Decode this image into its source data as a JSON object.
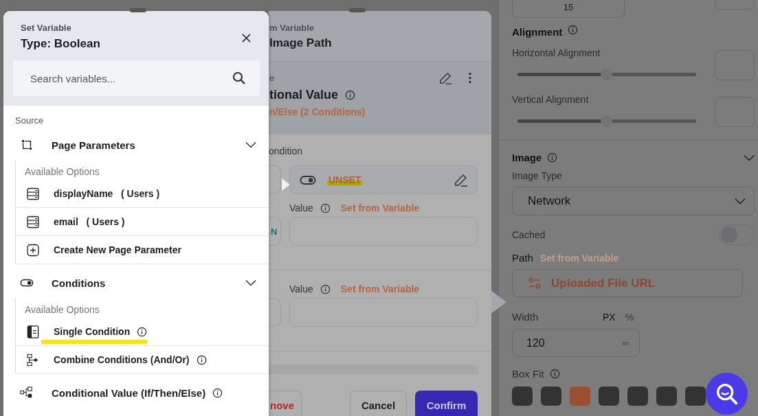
{
  "set_variable_panel": {
    "caption": "Set Variable",
    "title": "Type: Boolean",
    "search": {
      "placeholder": "Search variables..."
    },
    "source_label": "Source",
    "groups": [
      {
        "kind": "parameters",
        "label": "Page Parameters",
        "expanded": true,
        "options_label": "Available Options",
        "items": [
          {
            "kind": "field",
            "label": "displayName",
            "suffix": "( Users )",
            "info": false,
            "highlighted": false
          },
          {
            "kind": "field",
            "label": "email",
            "suffix": "( Users )",
            "info": false,
            "highlighted": false
          },
          {
            "kind": "create",
            "label": "Create New Page Parameter",
            "info": false,
            "highlighted": false
          }
        ]
      },
      {
        "kind": "conditions",
        "label": "Conditions",
        "expanded": true,
        "options_label": "Available Options",
        "items": [
          {
            "kind": "single",
            "label": "Single Condition",
            "info": true,
            "highlighted": true
          },
          {
            "kind": "combine",
            "label": "Combine Conditions (And/Or)",
            "info": true,
            "highlighted": false
          }
        ]
      },
      {
        "kind": "conditional",
        "label": "Conditional Value (If/Then/Else)",
        "info": true
      }
    ]
  },
  "value_panel": {
    "caption": "m Variable",
    "title": "Image Path",
    "section_caption": "e",
    "value_title": "tional Value",
    "value_subtitle": "n/Else (2 Conditions)",
    "condition_label": "ondition",
    "condition_chip": {
      "text": "UNSET",
      "highlighted": true
    },
    "rows": [
      {
        "label": "Value",
        "link": "Set from Variable",
        "fragment": "N"
      },
      {
        "label": "Value",
        "link": "Set from Variable"
      }
    ],
    "buttons": [
      {
        "kind": "danger",
        "label": "nove"
      },
      {
        "kind": "secondary",
        "label": "Cancel"
      },
      {
        "kind": "primary",
        "label": "Confirm"
      }
    ]
  },
  "properties": {
    "top_value": "15",
    "alignment_title": "Alignment",
    "sliders": [
      {
        "label": "Horizontal Alignment",
        "level": 0.5
      },
      {
        "label": "Vertical Alignment",
        "level": 0.5
      }
    ],
    "image_title": "Image",
    "image_type_label": "Image Type",
    "image_type": "Network",
    "cached_label": "Cached",
    "cached": false,
    "path_label": "Path",
    "path_link": "Set from Variable",
    "path_value": "Uploaded File URL",
    "width_label": "Width",
    "units": [
      {
        "label": "PX",
        "selected": true
      },
      {
        "label": "%",
        "selected": false
      }
    ],
    "width_value": "120",
    "width_suffix": "∞",
    "box_fit_label": "Box Fit",
    "box_fit_options": [
      {
        "selected": false
      },
      {
        "selected": false
      },
      {
        "selected": true
      },
      {
        "selected": false
      },
      {
        "selected": false
      },
      {
        "selected": false
      },
      {
        "selected": false
      }
    ]
  }
}
